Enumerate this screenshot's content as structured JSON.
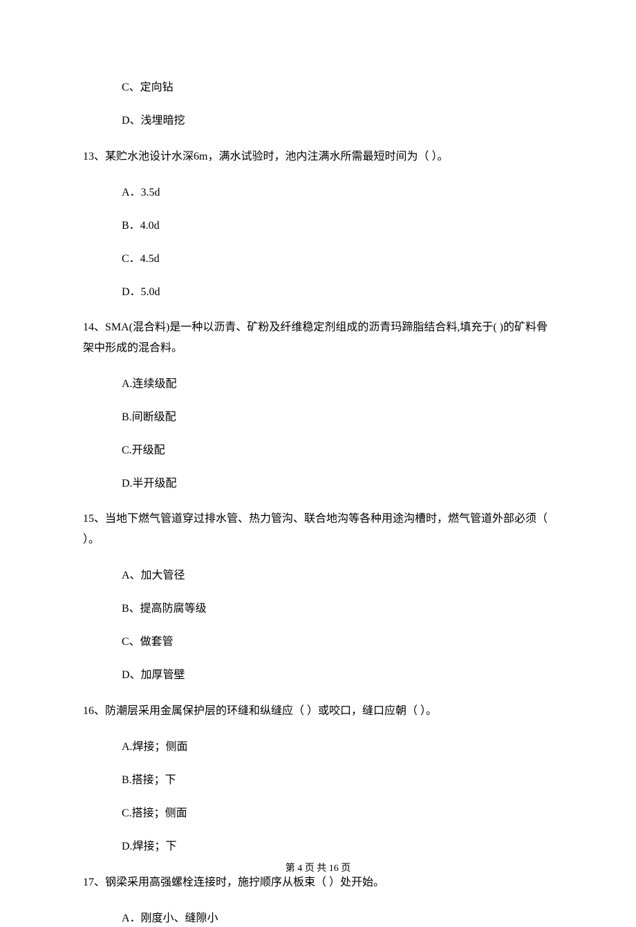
{
  "q12": {
    "optC": "C、定向钻",
    "optD": "D、浅埋暗挖"
  },
  "q13": {
    "text": "13、某贮水池设计水深6m，满水试验时，池内注满水所需最短时间为（    ）。",
    "optA": "A．3.5d",
    "optB": "B．4.0d",
    "optC": "C．4.5d",
    "optD": "D．5.0d"
  },
  "q14": {
    "text": "14、SMA(混合料)是一种以沥青、矿粉及纤维稳定剂组成的沥青玛蹄脂结合料,填充于(    )的矿料骨架中形成的混合料。",
    "optA": "A.连续级配",
    "optB": "B.间断级配",
    "optC": "C.开级配",
    "optD": "D.半开级配"
  },
  "q15": {
    "text": "15、当地下燃气管道穿过排水管、热力管沟、联合地沟等各种用途沟槽时，燃气管道外部必须（    ）。",
    "optA": "A、加大管径",
    "optB": "B、提高防腐等级",
    "optC": "C、做套管",
    "optD": "D、加厚管壁"
  },
  "q16": {
    "text": "16、防潮层采用金属保护层的环缝和纵缝应（    ）或咬口，缝口应朝（    ）。",
    "optA": "A.焊接；侧面",
    "optB": "B.搭接；下",
    "optC": "C.搭接；侧面",
    "optD": "D.焊接；下"
  },
  "q17": {
    "text": "17、钢梁采用高强螺栓连接时，施拧顺序从板束（     ）处开始。",
    "optA": "A．刚度小、缝隙小"
  },
  "footer": "第 4 页 共 16 页"
}
